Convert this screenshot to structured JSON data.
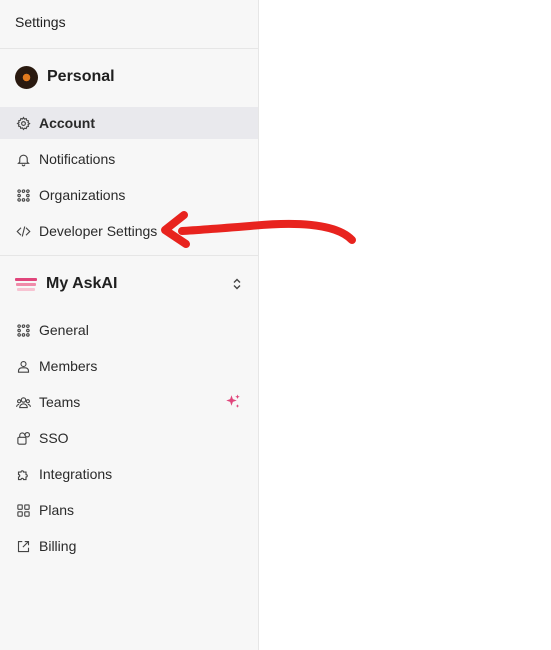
{
  "header": {
    "title": "Settings"
  },
  "personal": {
    "label": "Personal",
    "items": [
      {
        "label": "Account",
        "icon": "gear-icon",
        "active": true
      },
      {
        "label": "Notifications",
        "icon": "bell-icon"
      },
      {
        "label": "Organizations",
        "icon": "grid-dots-icon"
      },
      {
        "label": "Developer Settings",
        "icon": "code-icon"
      }
    ]
  },
  "workspace": {
    "label": "My AskAI",
    "items": [
      {
        "label": "General",
        "icon": "grid-dots-icon"
      },
      {
        "label": "Members",
        "icon": "user-icon"
      },
      {
        "label": "Teams",
        "icon": "users-icon"
      },
      {
        "label": "SSO",
        "icon": "sso-icon"
      },
      {
        "label": "Integrations",
        "icon": "puzzle-icon"
      },
      {
        "label": "Plans",
        "icon": "squares-icon"
      },
      {
        "label": "Billing",
        "icon": "external-link-icon"
      }
    ]
  },
  "colors": {
    "accent_arrow": "#e8231e",
    "sparkle": "#e0457b",
    "brand_stripes": [
      "#e0457b",
      "#f08aa9",
      "#f7c3d2"
    ]
  }
}
